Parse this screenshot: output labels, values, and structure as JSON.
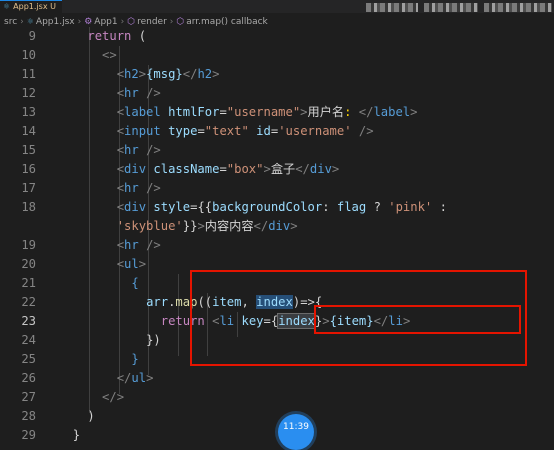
{
  "tab": {
    "label": "App1.jsx U"
  },
  "breadcrumb": {
    "src": "src",
    "file": "App1.jsx",
    "component": "App1",
    "method": "render",
    "callback": "arr.map() callback"
  },
  "timer": "11:39",
  "lines": [
    {
      "n": "9",
      "tokens": [
        [
          "    ",
          "txt"
        ],
        [
          "return",
          "kw"
        ],
        [
          " (",
          "txt"
        ]
      ]
    },
    {
      "n": "10",
      "tokens": [
        [
          "      ",
          "txt"
        ],
        [
          "<>",
          "brk"
        ]
      ]
    },
    {
      "n": "11",
      "tokens": [
        [
          "        ",
          "txt"
        ],
        [
          "<",
          "brk"
        ],
        [
          "h2",
          "tag"
        ],
        [
          ">",
          "brk"
        ],
        [
          "{msg}",
          "var"
        ],
        [
          "</",
          "brk"
        ],
        [
          "h2",
          "tag"
        ],
        [
          ">",
          "brk"
        ]
      ]
    },
    {
      "n": "12",
      "tokens": [
        [
          "        ",
          "txt"
        ],
        [
          "<",
          "brk"
        ],
        [
          "hr",
          "tag"
        ],
        [
          " />",
          "brk"
        ]
      ]
    },
    {
      "n": "13",
      "tokens": [
        [
          "        ",
          "txt"
        ],
        [
          "<",
          "brk"
        ],
        [
          "label",
          "tag"
        ],
        [
          " ",
          "txt"
        ],
        [
          "htmlFor",
          "attr"
        ],
        [
          "=",
          "txt"
        ],
        [
          "\"username\"",
          "str"
        ],
        [
          ">",
          "brk"
        ],
        [
          "用户名",
          "txt"
        ],
        [
          ":",
          "cur"
        ],
        [
          " </",
          "brk"
        ],
        [
          "label",
          "tag"
        ],
        [
          ">",
          "brk"
        ]
      ]
    },
    {
      "n": "14",
      "tokens": [
        [
          "        ",
          "txt"
        ],
        [
          "<",
          "brk"
        ],
        [
          "input",
          "tag"
        ],
        [
          " ",
          "txt"
        ],
        [
          "type",
          "attr"
        ],
        [
          "=",
          "txt"
        ],
        [
          "\"text\"",
          "str"
        ],
        [
          " ",
          "txt"
        ],
        [
          "id",
          "attr"
        ],
        [
          "=",
          "txt"
        ],
        [
          "'username'",
          "str"
        ],
        [
          " />",
          "brk"
        ]
      ]
    },
    {
      "n": "15",
      "tokens": [
        [
          "        ",
          "txt"
        ],
        [
          "<",
          "brk"
        ],
        [
          "hr",
          "tag"
        ],
        [
          " />",
          "brk"
        ]
      ]
    },
    {
      "n": "16",
      "tokens": [
        [
          "        ",
          "txt"
        ],
        [
          "<",
          "brk"
        ],
        [
          "div",
          "tag"
        ],
        [
          " ",
          "txt"
        ],
        [
          "className",
          "attr"
        ],
        [
          "=",
          "txt"
        ],
        [
          "\"box\"",
          "str"
        ],
        [
          ">",
          "brk"
        ],
        [
          "盒子",
          "txt"
        ],
        [
          "</",
          "brk"
        ],
        [
          "div",
          "tag"
        ],
        [
          ">",
          "brk"
        ]
      ]
    },
    {
      "n": "17",
      "tokens": [
        [
          "        ",
          "txt"
        ],
        [
          "<",
          "brk"
        ],
        [
          "hr",
          "tag"
        ],
        [
          " />",
          "brk"
        ]
      ]
    },
    {
      "n": "18",
      "tokens": [
        [
          "        ",
          "txt"
        ],
        [
          "<",
          "brk"
        ],
        [
          "div",
          "tag"
        ],
        [
          " ",
          "txt"
        ],
        [
          "style",
          "attr"
        ],
        [
          "=",
          "txt"
        ],
        [
          "{{",
          "txt"
        ],
        [
          "backgroundColor",
          "var"
        ],
        [
          ": ",
          "txt"
        ],
        [
          "flag",
          "var"
        ],
        [
          " ? ",
          "txt"
        ],
        [
          "'pink'",
          "str"
        ],
        [
          " :",
          "txt"
        ]
      ]
    },
    {
      "n": "",
      "tokens": [
        [
          "        ",
          "txt"
        ],
        [
          "'skyblue'",
          "str"
        ],
        [
          "}}",
          "txt"
        ],
        [
          ">",
          "brk"
        ],
        [
          "内容内容",
          "txt"
        ],
        [
          "</",
          "brk"
        ],
        [
          "div",
          "tag"
        ],
        [
          ">",
          "brk"
        ]
      ]
    },
    {
      "n": "19",
      "tokens": [
        [
          "        ",
          "txt"
        ],
        [
          "<",
          "brk"
        ],
        [
          "hr",
          "tag"
        ],
        [
          " />",
          "brk"
        ]
      ]
    },
    {
      "n": "20",
      "tokens": [
        [
          "        ",
          "txt"
        ],
        [
          "<",
          "brk"
        ],
        [
          "ul",
          "tag"
        ],
        [
          ">",
          "brk"
        ]
      ]
    },
    {
      "n": "21",
      "tokens": [
        [
          "          ",
          "txt"
        ],
        [
          "{",
          "tag"
        ]
      ]
    },
    {
      "n": "22",
      "tokens": [
        [
          "            ",
          "txt"
        ],
        [
          "arr",
          "var"
        ],
        [
          ".",
          "txt"
        ],
        [
          "map",
          "fn"
        ],
        [
          "((",
          "txt"
        ],
        [
          "item",
          "var"
        ],
        [
          ", ",
          "txt"
        ],
        [
          "index",
          "idx"
        ],
        [
          ")=>{",
          "txt"
        ]
      ]
    },
    {
      "n": "23",
      "tokens": [
        [
          "              ",
          "txt"
        ],
        [
          "return",
          "kw"
        ],
        [
          " ",
          "txt"
        ],
        [
          "<",
          "brk"
        ],
        [
          "li",
          "tag"
        ],
        [
          " ",
          "txt"
        ],
        [
          "key",
          "attr"
        ],
        [
          "=",
          "txt"
        ],
        [
          "{",
          "txt"
        ],
        [
          "index",
          "idx2"
        ],
        [
          "}",
          "txt"
        ],
        [
          ">",
          "brk"
        ],
        [
          "{item}",
          "var"
        ],
        [
          "</",
          "brk"
        ],
        [
          "li",
          "tag"
        ],
        [
          ">",
          "brk"
        ]
      ]
    },
    {
      "n": "24",
      "tokens": [
        [
          "            ",
          "txt"
        ],
        [
          "})",
          "txt"
        ]
      ]
    },
    {
      "n": "25",
      "tokens": [
        [
          "          ",
          "txt"
        ],
        [
          "}",
          "tag"
        ]
      ]
    },
    {
      "n": "26",
      "tokens": [
        [
          "        ",
          "txt"
        ],
        [
          "</",
          "brk"
        ],
        [
          "ul",
          "tag"
        ],
        [
          ">",
          "brk"
        ]
      ]
    },
    {
      "n": "27",
      "tokens": [
        [
          "      ",
          "txt"
        ],
        [
          "</>",
          "brk"
        ]
      ]
    },
    {
      "n": "28",
      "tokens": [
        [
          "    ",
          "txt"
        ],
        [
          ")",
          "txt"
        ]
      ]
    },
    {
      "n": "29",
      "tokens": [
        [
          "  ",
          "txt"
        ],
        [
          "}",
          "txt"
        ]
      ]
    }
  ]
}
